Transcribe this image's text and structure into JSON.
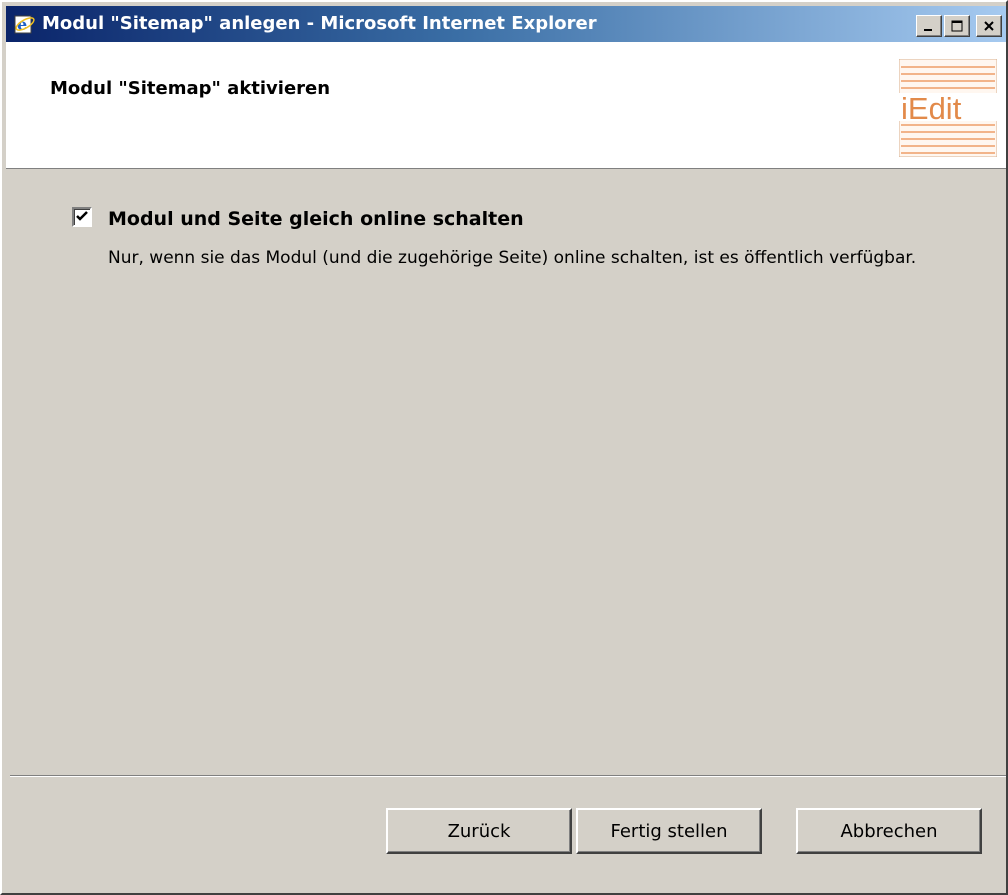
{
  "window": {
    "title": "Modul \"Sitemap\" anlegen - Microsoft Internet Explorer",
    "controls": {
      "minimize": "_",
      "maximize": "□",
      "close": "✕"
    }
  },
  "header": {
    "title": "Modul \"Sitemap\" aktivieren",
    "logo_text": "iEdit"
  },
  "content": {
    "online_checkbox": {
      "checked": true,
      "label": "Modul und Seite gleich online schalten",
      "description": "Nur, wenn sie das Modul (und die zugehörige Seite) online schalten, ist es öffentlich verfügbar."
    }
  },
  "buttons": {
    "back": "Zurück",
    "finish": "Fertig stellen",
    "cancel": "Abbrechen"
  },
  "colors": {
    "dialog_bg": "#d4d0c8",
    "titlebar_start": "#0a246a",
    "titlebar_end": "#a6caf0",
    "logo_stripes": "#f2b48a"
  }
}
